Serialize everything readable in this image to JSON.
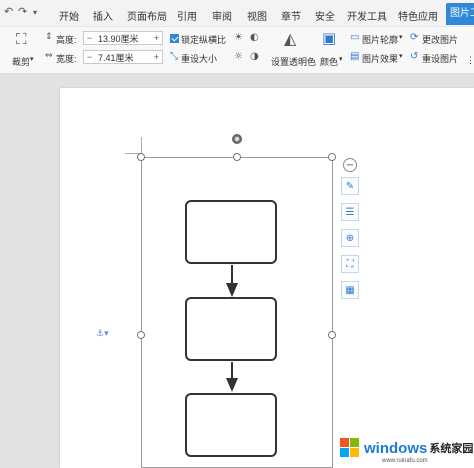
{
  "menubar": {
    "items": [
      "开始",
      "插入",
      "页面布局",
      "引用",
      "审阅",
      "视图",
      "章节",
      "安全",
      "开发工具",
      "特色应用",
      "图片工"
    ],
    "active_index": 10,
    "undo_icon": "undo-icon",
    "redo_icon": "redo-icon",
    "dropdown_icon": "chevron-down-icon"
  },
  "ribbon": {
    "crop_label": "裁剪",
    "height_label": "高度:",
    "height_value": "13.90厘米",
    "width_label": "宽度:",
    "width_value": "7.41厘米",
    "lock_ratio_label": "锁定纵横比",
    "reset_size_label": "重设大小",
    "set_transparent_label": "设置透明色",
    "color_label": "颜色",
    "picture_outline_label": "图片轮廓",
    "picture_effect_label": "图片效果",
    "change_picture_label": "更改图片",
    "reset_picture_label": "重设图片",
    "minus": "−",
    "plus": "+",
    "lock_ratio_checked": true
  },
  "canvas": {
    "collapse_symbol": "−",
    "tool_icons": [
      "edit-picture-icon",
      "text-wrap-icon",
      "zoom-icon",
      "crop-icon",
      "picture-format-icon"
    ],
    "flowchart_box_count": 3,
    "anchor_icon": "anchor-icon"
  },
  "watermark": {
    "brand": "windows",
    "suffix": "系统家园",
    "url": "www.ruinafu.com"
  },
  "colors": {
    "accent": "#2f88d8",
    "ribbon_bg": "#f8f8f8",
    "workspace_bg": "#e2e2e2",
    "shape_stroke": "#333333"
  }
}
